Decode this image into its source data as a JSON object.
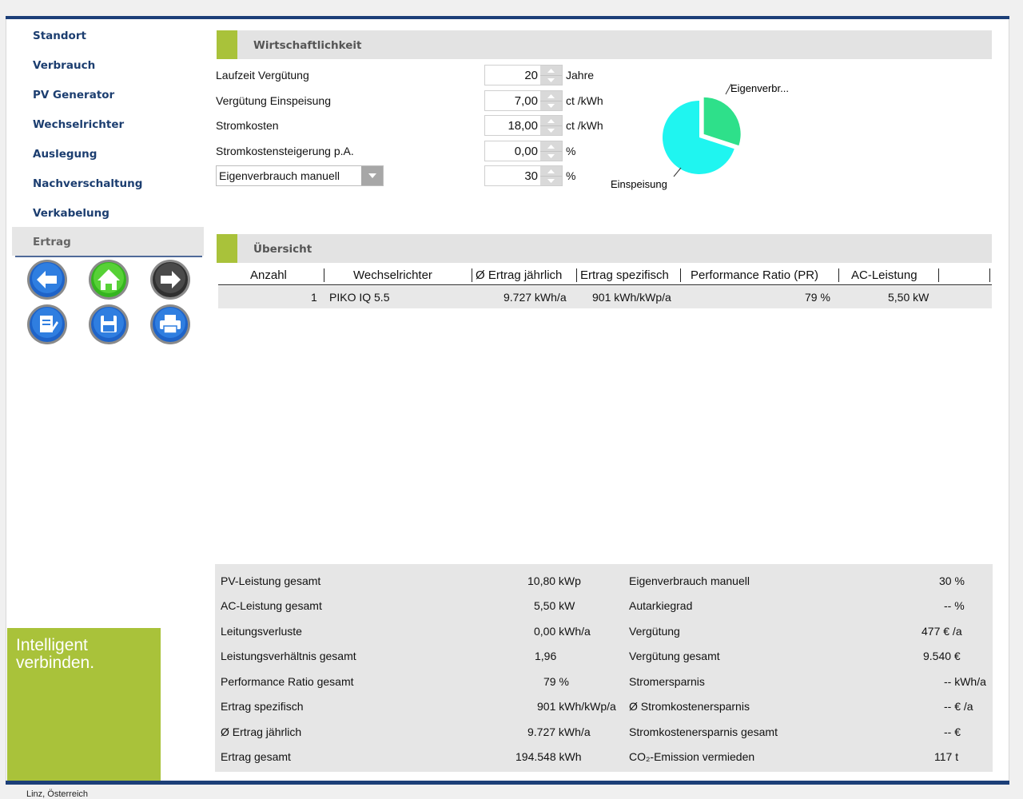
{
  "nav": {
    "items": [
      "Standort",
      "Verbrauch",
      "PV Generator",
      "Wechselrichter",
      "Auslegung",
      "Nachverschaltung",
      "Verkabelung"
    ],
    "active": "Ertrag"
  },
  "brand": {
    "slogan_line1": "Intelligent",
    "slogan_line2": "verbinden.",
    "color": "#a9c23a"
  },
  "economy": {
    "title": "Wirtschaftlichkeit",
    "rows": [
      {
        "label": "Laufzeit Vergütung",
        "value": "20",
        "unit": "Jahre"
      },
      {
        "label": "Vergütung Einspeisung",
        "value": "7,00",
        "unit": "ct /kWh"
      },
      {
        "label": "Stromkosten",
        "value": "18,00",
        "unit": "ct /kWh"
      },
      {
        "label": "Stromkostensteigerung p.A.",
        "value": "0,00",
        "unit": "%"
      }
    ],
    "dropdown": {
      "selected": "Eigenverbrauch manuell",
      "value": "30",
      "unit": "%"
    }
  },
  "chart_data": {
    "type": "pie",
    "labels": [
      "Eigenverbr...",
      "Einspeisung"
    ],
    "values": [
      30,
      70
    ],
    "colors": [
      "#2ee08a",
      "#1ff5f0"
    ]
  },
  "overview": {
    "title": "Übersicht",
    "columns": [
      "Anzahl",
      "Wechselrichter",
      "Ø Ertrag jährlich",
      "Ertrag spezifisch",
      "Performance Ratio (PR)",
      "AC-Leistung"
    ],
    "rows": [
      {
        "count": "1",
        "inverter": "PIKO IQ 5.5",
        "yield_year": "9.727 kWh/a",
        "yield_specific": "901 kWh/kWp/a",
        "pr": "79 %",
        "ac_power": "5,50 kW"
      }
    ]
  },
  "summary": {
    "left": [
      {
        "label": "PV-Leistung gesamt",
        "value": "10,80 kWp"
      },
      {
        "label": "AC-Leistung gesamt",
        "value": "5,50 kW"
      },
      {
        "label": "Leitungsverluste",
        "value": "0,00 kWh/a"
      },
      {
        "label": "Leistungsverhältnis gesamt",
        "value": "1,96"
      },
      {
        "label": "Performance Ratio gesamt",
        "value": "79 %"
      },
      {
        "label": "Ertrag spezifisch",
        "value": "901 kWh/kWp/a"
      },
      {
        "label": "Ø Ertrag jährlich",
        "value": "9.727 kWh/a"
      },
      {
        "label": "Ertrag gesamt",
        "value": "194.548 kWh"
      }
    ],
    "right": [
      {
        "label": "Eigenverbrauch manuell",
        "value": "30 %"
      },
      {
        "label": "Autarkiegrad",
        "value": "-- %"
      },
      {
        "label": "Vergütung",
        "value": "477 € /a"
      },
      {
        "label": "Vergütung gesamt",
        "value": "9.540 €"
      },
      {
        "label": "Stromersparnis",
        "value": "-- kWh/a"
      },
      {
        "label": "Ø Stromkostenersparnis",
        "value": "-- € /a"
      },
      {
        "label": "Stromkostenersparnis gesamt",
        "value": "-- €"
      },
      {
        "label": "CO₂-Emission vermieden",
        "value": "117 t"
      }
    ]
  },
  "footer": {
    "location": "Linz, Österreich"
  }
}
